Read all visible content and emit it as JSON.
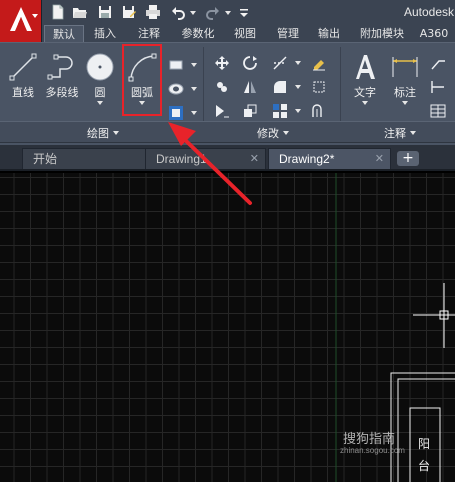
{
  "app": {
    "title": "Autodesk",
    "logo_letter": "A",
    "accent": "#c41a1a"
  },
  "quick_access": [
    "new-icon",
    "open-icon",
    "save-icon",
    "save-as-icon",
    "print-icon",
    "undo-icon",
    "redo-icon",
    "customize-icon"
  ],
  "ribbon_tabs": [
    {
      "label": "默认",
      "active": true
    },
    {
      "label": "插入",
      "active": false
    },
    {
      "label": "注释",
      "active": false
    },
    {
      "label": "参数化",
      "active": false
    },
    {
      "label": "视图",
      "active": false
    },
    {
      "label": "管理",
      "active": false
    },
    {
      "label": "输出",
      "active": false
    },
    {
      "label": "附加模块",
      "active": false
    },
    {
      "label": "A360",
      "active": false
    }
  ],
  "draw_panel": {
    "label": "绘图",
    "tools": [
      {
        "label": "直线",
        "icon": "line-icon"
      },
      {
        "label": "多段线",
        "icon": "polyline-icon"
      },
      {
        "label": "圆",
        "icon": "circle-icon"
      },
      {
        "label": "圆弧",
        "icon": "arc-icon",
        "highlighted": true
      }
    ]
  },
  "modify_panel": {
    "label": "修改"
  },
  "annotate_panel": {
    "label": "注释",
    "tools": [
      {
        "label": "文字",
        "icon": "text-icon"
      },
      {
        "label": "标注",
        "icon": "dimension-icon"
      }
    ]
  },
  "doc_tabs": [
    {
      "label": "开始",
      "active": false,
      "closable": false
    },
    {
      "label": "Drawing1",
      "active": false,
      "closable": true
    },
    {
      "label": "Drawing2*",
      "active": true,
      "closable": true
    }
  ],
  "add_tab": "+",
  "close_glyph": "✕",
  "drawing_text": [
    "阳",
    "台"
  ],
  "watermark": {
    "brand": "搜狗指南",
    "url": "zhinan.sogou.com"
  },
  "annotation_color": "#e8232a"
}
